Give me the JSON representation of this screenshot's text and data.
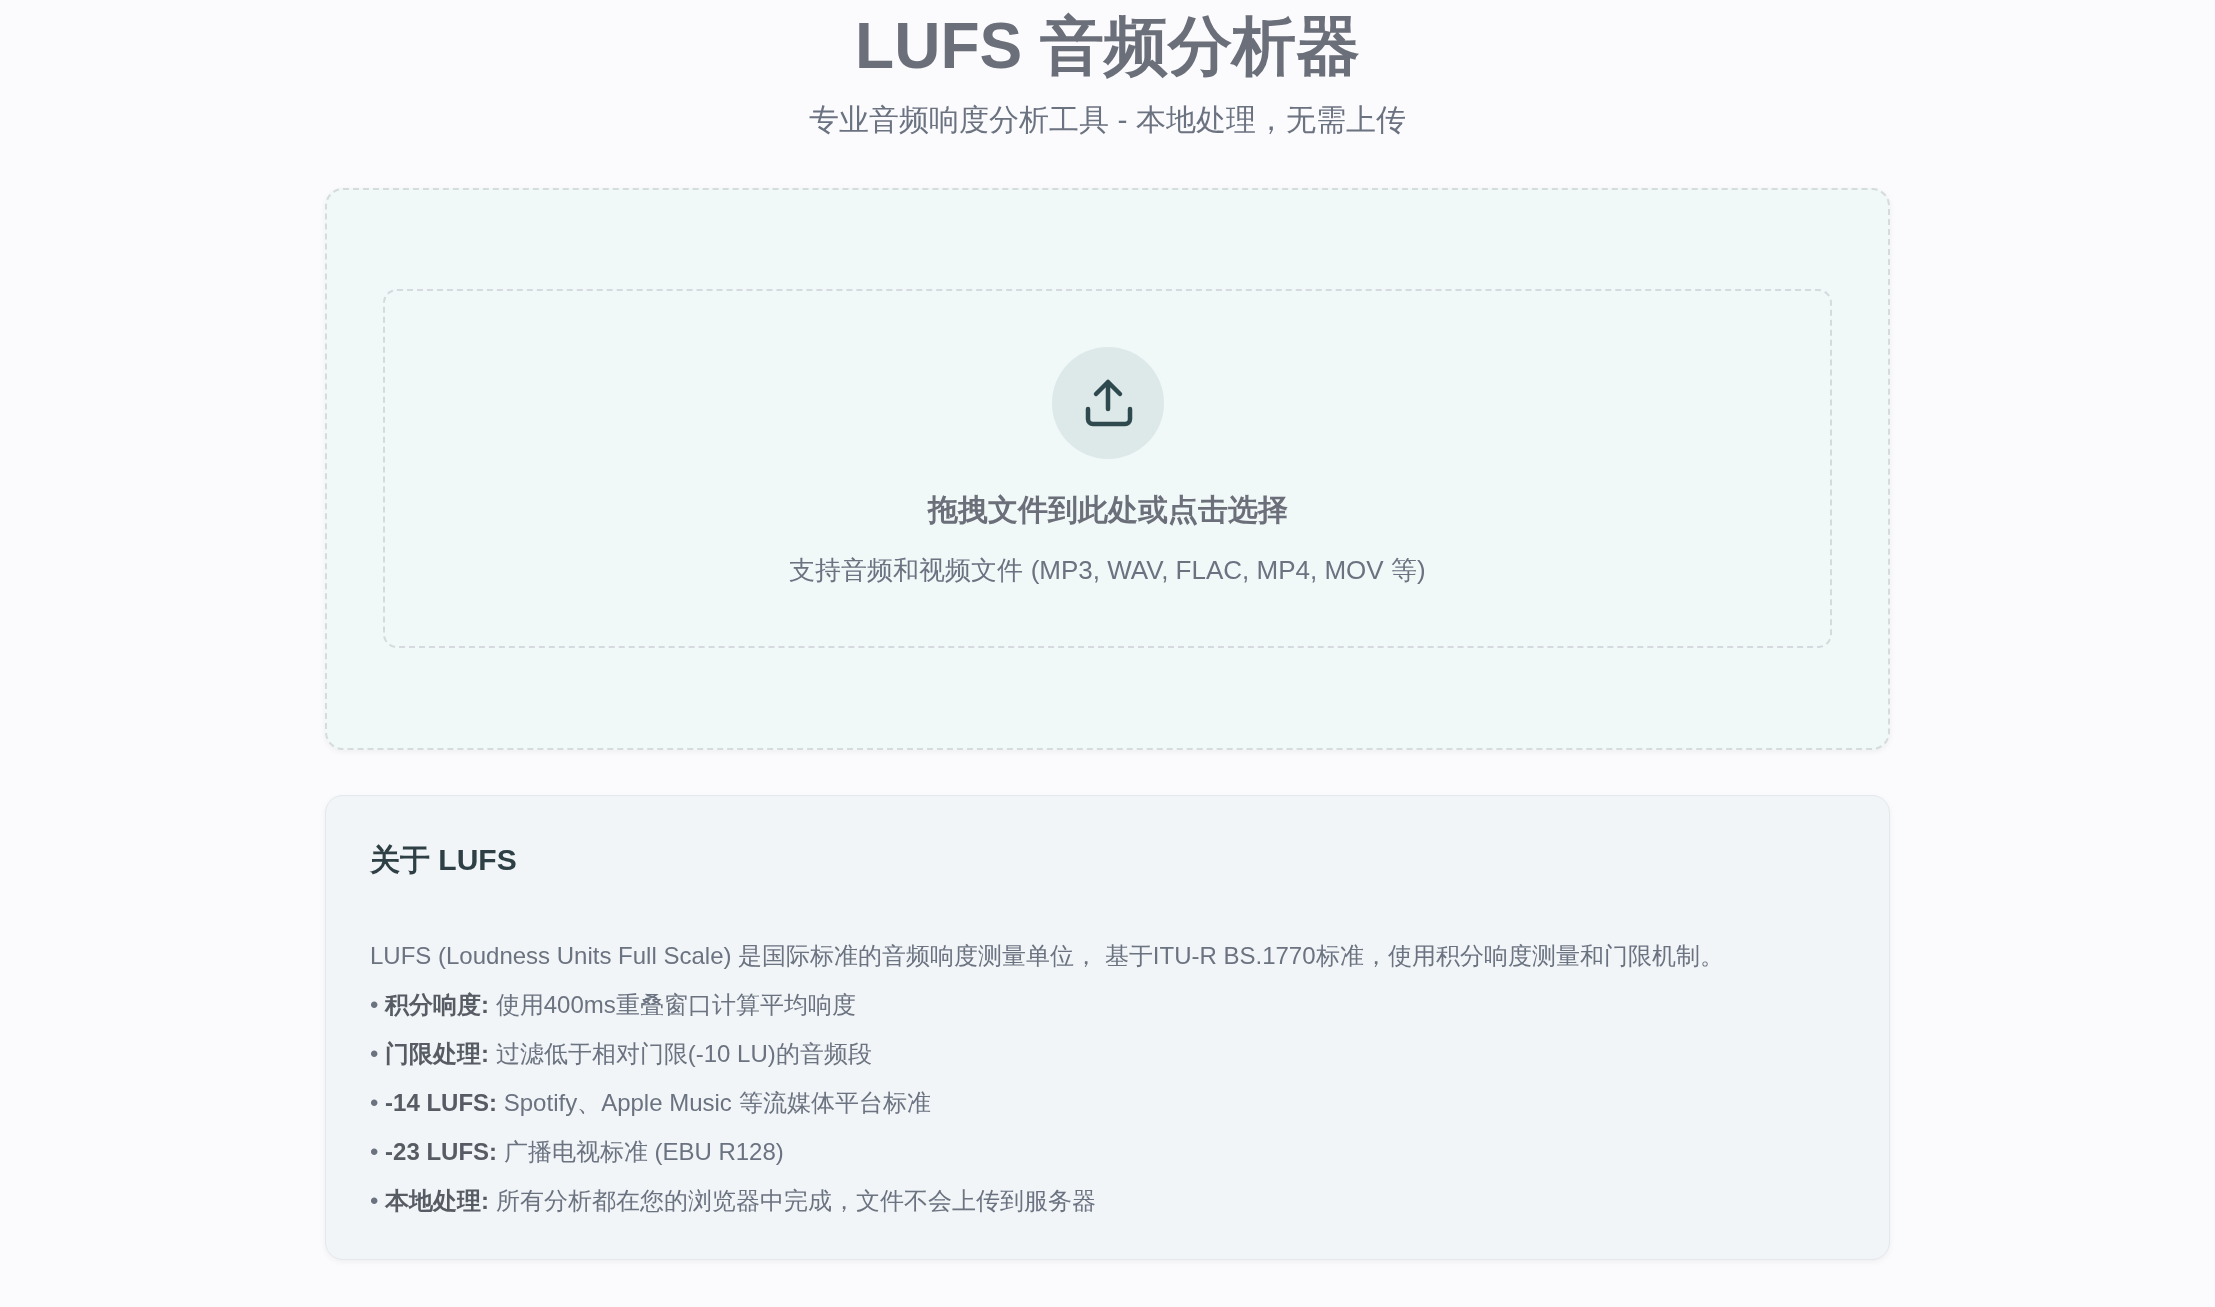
{
  "header": {
    "title": "LUFS 音频分析器",
    "subtitle": "专业音频响度分析工具 - 本地处理，无需上传"
  },
  "upload": {
    "prompt": "拖拽文件到此处或点击选择",
    "hint": "支持音频和视频文件 (MP3, WAV, FLAC, MP4, MOV 等)"
  },
  "about": {
    "title": "关于 LUFS",
    "intro": "LUFS (Loudness Units Full Scale) 是国际标准的音频响度测量单位， 基于ITU-R BS.1770标准，使用积分响度测量和门限机制。",
    "points": [
      "• **积分响度:** 使用400ms重叠窗口计算平均响度",
      "• **门限处理:** 过滤低于相对门限(-10 LU)的音频段",
      "• **-14 LUFS:** Spotify、Apple Music 等流媒体平台标准",
      "• **-23 LUFS:** 广播电视标准 (EBU R128)",
      "• **本地处理:** 所有分析都在您的浏览器中完成，文件不会上传到服务器"
    ]
  }
}
